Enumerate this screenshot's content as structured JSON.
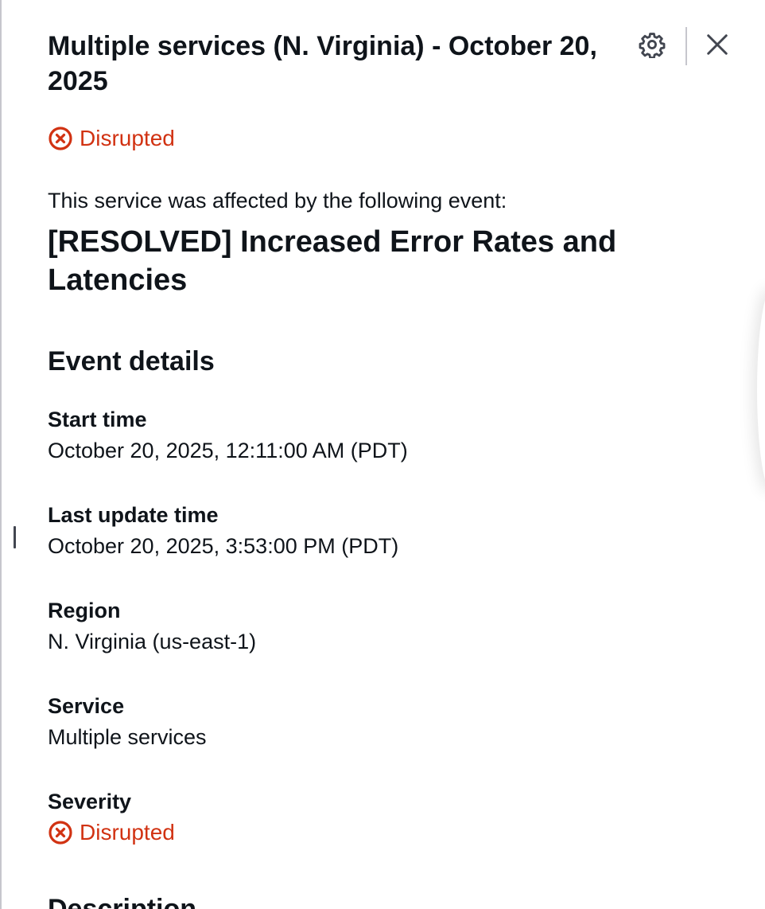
{
  "header": {
    "title": "Multiple services (N. Virginia) - October 20, 2025"
  },
  "status": {
    "label": "Disrupted",
    "color": "#d13212"
  },
  "intro_text": "This service was affected by the following event:",
  "event_title": "[RESOLVED] Increased Error Rates and Latencies",
  "event_details": {
    "heading": "Event details",
    "start_time": {
      "label": "Start time",
      "value": "October 20, 2025, 12:11:00 AM (PDT)"
    },
    "last_update_time": {
      "label": "Last update time",
      "value": "October 20, 2025, 3:53:00 PM (PDT)"
    },
    "region": {
      "label": "Region",
      "value": "N. Virginia (us-east-1)"
    },
    "service": {
      "label": "Service",
      "value": "Multiple services"
    },
    "severity": {
      "label": "Severity",
      "value": "Disrupted"
    }
  },
  "description": {
    "heading": "Description"
  },
  "icons": {
    "settings": "gear-icon",
    "close": "close-icon",
    "status": "error-circle-icon"
  }
}
